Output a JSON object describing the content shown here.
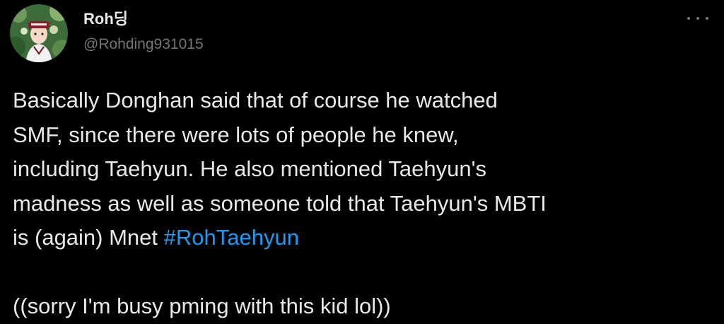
{
  "user": {
    "display_name": "Roh딩",
    "handle": "@Rohding931015",
    "avatar_icon": "profile-avatar"
  },
  "menu": {
    "icon": "more-options-icon"
  },
  "tweet": {
    "lines": [
      "Basically Donghan said that of course he watched",
      "SMF, since there were lots of people he knew,",
      "including Taehyun. He also mentioned Taehyun's",
      "madness as well as someone told that Taehyun's MBTI",
      "is (again) Mnet "
    ],
    "hashtag": "#RohTaehyun",
    "closing_line": "((sorry I'm busy pming with this kid lol))"
  },
  "colors": {
    "background": "#000000",
    "text": "#e7e9ea",
    "secondary": "#71767b",
    "accent": "#1d9bf0"
  }
}
